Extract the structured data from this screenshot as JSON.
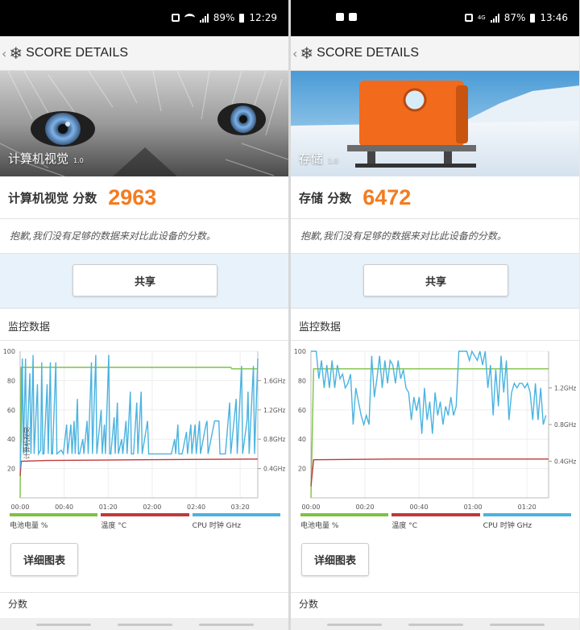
{
  "left": {
    "status": {
      "battery": "89%",
      "time": "12:29"
    },
    "header": {
      "title": "SCORE DETAILS"
    },
    "hero": {
      "label": "计算机视觉",
      "version": "1.0"
    },
    "score": {
      "label": "计算机视觉 分数",
      "value": "2963"
    },
    "message": "抱歉,我们没有足够的数据来对比此设备的分数。",
    "share_label": "共享",
    "monitor_title": "监控数据",
    "chart_marker": "计算机视觉",
    "detail_label": "详细图表",
    "score_section": "分数"
  },
  "right": {
    "status": {
      "battery": "87%",
      "time": "13:46"
    },
    "header": {
      "title": "SCORE DETAILS"
    },
    "hero": {
      "label": "存储",
      "version": "1.0"
    },
    "score": {
      "label": "存储 分数",
      "value": "6472"
    },
    "message": "抱歉,我们没有足够的数据来对比此设备的分数。",
    "share_label": "共享",
    "monitor_title": "监控数据",
    "detail_label": "详细图表",
    "score_section": "分数"
  },
  "legend": {
    "battery": "电池电量 %",
    "temp": "温度 °C",
    "cpu": "CPU 时钟 GHz"
  },
  "colors": {
    "accent": "#f47b20",
    "battery": "#7dc242",
    "temp": "#c0393b",
    "cpu": "#4ab3e0"
  },
  "chart_data": [
    {
      "type": "line",
      "ylim": [
        0,
        100
      ],
      "y_ticks": [
        20,
        40,
        60,
        80,
        100
      ],
      "x_ticks": [
        "00:00",
        "00:40",
        "01:20",
        "02:00",
        "02:40",
        "03:20"
      ],
      "xlim_seconds": [
        0,
        220
      ],
      "y2_ticks": [
        "0.4GHz",
        "0.8GHz",
        "1.2GHz",
        "1.6GHz"
      ],
      "y2_values": [
        0.4,
        0.8,
        1.2,
        1.6
      ],
      "y2lim": [
        0,
        2.0
      ],
      "series": [
        {
          "name": "电池电量 %",
          "points": [
            [
              0,
              0
            ],
            [
              1,
              89
            ],
            [
              195,
              89
            ],
            [
              196,
              88
            ],
            [
              220,
              88
            ]
          ]
        },
        {
          "name": "温度 °C",
          "points": [
            [
              0,
              15
            ],
            [
              1,
              25
            ],
            [
              25,
              25.5
            ],
            [
              110,
              26
            ],
            [
              220,
              26.5
            ]
          ]
        },
        {
          "name": "CPU 时钟 GHz",
          "points": [
            [
              0,
              0.4
            ],
            [
              1,
              0.8
            ],
            [
              2,
              1.9
            ],
            [
              3,
              0.6
            ],
            [
              5,
              1.9
            ],
            [
              6,
              0.6
            ],
            [
              9,
              1.7
            ],
            [
              10,
              0.6
            ],
            [
              12,
              1.95
            ],
            [
              13,
              0.6
            ],
            [
              16,
              1.55
            ],
            [
              17,
              0.6
            ],
            [
              19,
              0.65
            ],
            [
              20,
              1.85
            ],
            [
              21,
              0.6
            ],
            [
              22,
              0.6
            ],
            [
              25,
              1.55
            ],
            [
              26,
              0.6
            ],
            [
              28,
              1.85
            ],
            [
              29,
              0.6
            ],
            [
              30,
              0.6
            ],
            [
              33,
              1.85
            ],
            [
              34,
              0.6
            ],
            [
              38,
              0.65
            ],
            [
              40,
              0.6
            ],
            [
              43,
              1.0
            ],
            [
              44,
              0.6
            ],
            [
              47,
              1.0
            ],
            [
              48,
              0.6
            ],
            [
              50,
              1.05
            ],
            [
              51,
              0.6
            ],
            [
              53,
              1.35
            ],
            [
              54,
              0.6
            ],
            [
              55,
              0.6
            ],
            [
              58,
              0.8
            ],
            [
              59,
              0.6
            ],
            [
              62,
              1.05
            ],
            [
              63,
              0.6
            ],
            [
              66,
              1.85
            ],
            [
              67,
              0.6
            ],
            [
              70,
              1.95
            ],
            [
              71,
              0.6
            ],
            [
              75,
              1.2
            ],
            [
              76,
              0.6
            ],
            [
              78,
              1.0
            ],
            [
              79,
              0.6
            ],
            [
              82,
              1.95
            ],
            [
              83,
              0.6
            ],
            [
              84,
              0.6
            ],
            [
              87,
              1.1
            ],
            [
              88,
              0.6
            ],
            [
              90,
              1.3
            ],
            [
              91,
              0.6
            ],
            [
              94,
              0.8
            ],
            [
              95,
              0.6
            ],
            [
              98,
              1.05
            ],
            [
              99,
              0.6
            ],
            [
              102,
              1.45
            ],
            [
              103,
              0.6
            ],
            [
              105,
              0.6
            ],
            [
              108,
              1.3
            ],
            [
              109,
              0.6
            ],
            [
              112,
              1.45
            ],
            [
              113,
              0.6
            ],
            [
              118,
              1.05
            ],
            [
              119,
              0.6
            ],
            [
              140,
              0.6
            ],
            [
              143,
              0.8
            ],
            [
              144,
              0.6
            ],
            [
              146,
              1.0
            ],
            [
              147,
              0.6
            ],
            [
              150,
              0.6
            ],
            [
              154,
              0.9
            ],
            [
              155,
              0.6
            ],
            [
              158,
              1.0
            ],
            [
              159,
              0.6
            ],
            [
              162,
              1.0
            ],
            [
              163,
              0.6
            ],
            [
              166,
              1.05
            ],
            [
              167,
              0.6
            ],
            [
              172,
              1.0
            ],
            [
              173,
              1.05
            ],
            [
              174,
              0.6
            ],
            [
              180,
              1.05
            ],
            [
              184,
              1.05
            ],
            [
              185,
              0.6
            ],
            [
              190,
              0.6
            ],
            [
              194,
              1.3
            ],
            [
              195,
              0.6
            ],
            [
              200,
              1.35
            ],
            [
              201,
              0.6
            ],
            [
              205,
              1.8
            ],
            [
              206,
              0.6
            ],
            [
              210,
              1.05
            ],
            [
              211,
              1.45
            ],
            [
              212,
              0.6
            ],
            [
              216,
              1.8
            ],
            [
              217,
              0.6
            ],
            [
              220,
              1.9
            ]
          ]
        }
      ]
    },
    {
      "type": "line",
      "ylim": [
        0,
        100
      ],
      "y_ticks": [
        20,
        40,
        60,
        80,
        100
      ],
      "x_ticks": [
        "00:00",
        "00:20",
        "00:40",
        "01:00",
        "01:20"
      ],
      "xlim_seconds": [
        0,
        90
      ],
      "y2_ticks": [
        "0.4GHz",
        "0.8GHz",
        "1.2GHz"
      ],
      "y2_values": [
        0.4,
        0.8,
        1.2
      ],
      "y2lim": [
        0,
        1.6
      ],
      "series": [
        {
          "name": "电池电量 %",
          "points": [
            [
              0,
              0
            ],
            [
              1,
              88
            ],
            [
              90,
              88
            ]
          ]
        },
        {
          "name": "温度 °C",
          "points": [
            [
              0,
              8
            ],
            [
              1,
              26
            ],
            [
              30,
              26.5
            ],
            [
              90,
              26.5
            ]
          ]
        },
        {
          "name": "CPU 时钟 GHz",
          "points": [
            [
              0,
              1.6
            ],
            [
              2,
              1.6
            ],
            [
              3,
              1.3
            ],
            [
              4,
              1.5
            ],
            [
              5,
              1.2
            ],
            [
              6,
              1.45
            ],
            [
              7,
              1.2
            ],
            [
              8,
              1.5
            ],
            [
              9,
              1.2
            ],
            [
              10,
              1.45
            ],
            [
              11,
              1.3
            ],
            [
              12,
              1.35
            ],
            [
              13,
              1.2
            ],
            [
              14,
              1.25
            ],
            [
              15,
              1.35
            ],
            [
              16,
              0.8
            ],
            [
              17,
              1.2
            ],
            [
              18,
              1.05
            ],
            [
              19,
              0.9
            ],
            [
              20,
              0.8
            ],
            [
              21,
              0.9
            ],
            [
              22,
              0.8
            ],
            [
              23,
              1.55
            ],
            [
              24,
              1.1
            ],
            [
              25,
              1.3
            ],
            [
              26,
              1.55
            ],
            [
              27,
              1.2
            ],
            [
              28,
              1.5
            ],
            [
              29,
              1.25
            ],
            [
              30,
              1.5
            ],
            [
              31,
              1.45
            ],
            [
              32,
              1.25
            ],
            [
              33,
              1.5
            ],
            [
              34,
              1.3
            ],
            [
              35,
              1.4
            ],
            [
              36,
              1.2
            ],
            [
              37,
              1.15
            ],
            [
              38,
              0.85
            ],
            [
              39,
              1.1
            ],
            [
              40,
              0.95
            ],
            [
              41,
              1.1
            ],
            [
              42,
              0.7
            ],
            [
              43,
              1.2
            ],
            [
              44,
              0.85
            ],
            [
              45,
              1.05
            ],
            [
              46,
              0.7
            ],
            [
              47,
              1.15
            ],
            [
              48,
              0.9
            ],
            [
              49,
              1.05
            ],
            [
              50,
              0.8
            ],
            [
              51,
              1.0
            ],
            [
              52,
              0.9
            ],
            [
              53,
              1.1
            ],
            [
              54,
              0.9
            ],
            [
              55,
              1.0
            ],
            [
              56,
              1.6
            ],
            [
              59,
              1.6
            ],
            [
              60,
              1.5
            ],
            [
              61,
              1.6
            ],
            [
              63,
              1.5
            ],
            [
              64,
              1.6
            ],
            [
              65,
              1.45
            ],
            [
              66,
              1.6
            ],
            [
              67,
              1.2
            ],
            [
              68,
              1.45
            ],
            [
              69,
              0.9
            ],
            [
              70,
              1.4
            ],
            [
              71,
              1.0
            ],
            [
              72,
              1.55
            ],
            [
              73,
              1.15
            ],
            [
              74,
              1.5
            ],
            [
              75,
              0.85
            ],
            [
              76,
              1.15
            ],
            [
              77,
              1.25
            ],
            [
              78,
              1.2
            ],
            [
              79,
              1.25
            ],
            [
              80,
              1.25
            ],
            [
              81,
              1.2
            ],
            [
              82,
              1.25
            ],
            [
              83,
              1.15
            ],
            [
              84,
              0.85
            ],
            [
              85,
              1.25
            ],
            [
              86,
              0.85
            ],
            [
              87,
              1.2
            ],
            [
              88,
              0.8
            ],
            [
              89,
              0.9
            ]
          ]
        }
      ]
    }
  ]
}
